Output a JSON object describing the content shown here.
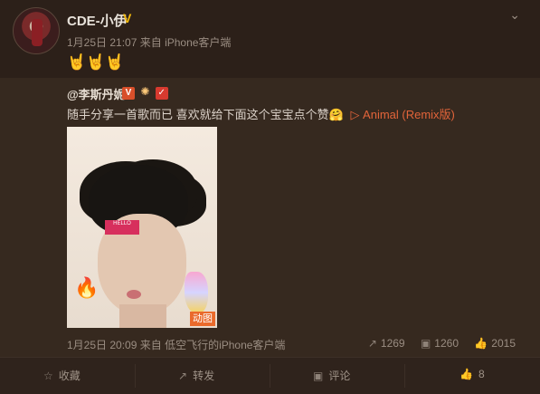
{
  "post": {
    "username": "CDE-小伊",
    "timestamp": "1月25日 21:07",
    "source": "来自 iPhone客户端",
    "emoji": "🤘🤘🤘"
  },
  "repost": {
    "username": "@李斯丹妮",
    "text": "随手分享一首歌而已 喜欢就给下面这个宝宝点个赞🤗",
    "music_label": "▷ Animal (Remix版)",
    "timestamp": "1月25日 20:09",
    "source": "来自 低空飞行的iPhone客户端",
    "share_count": "1269",
    "comment_count": "1260",
    "like_count": "2015",
    "gif_label": "动图"
  },
  "actions": {
    "collect": "收藏",
    "forward": "转发",
    "comment": "评论",
    "like": "8"
  },
  "icons": {
    "verified": "verified-badge-icon",
    "chevron": "chevron-down-icon",
    "collect": "star-icon",
    "forward": "forward-icon",
    "comment": "comment-icon",
    "like": "thumb-up-icon"
  }
}
